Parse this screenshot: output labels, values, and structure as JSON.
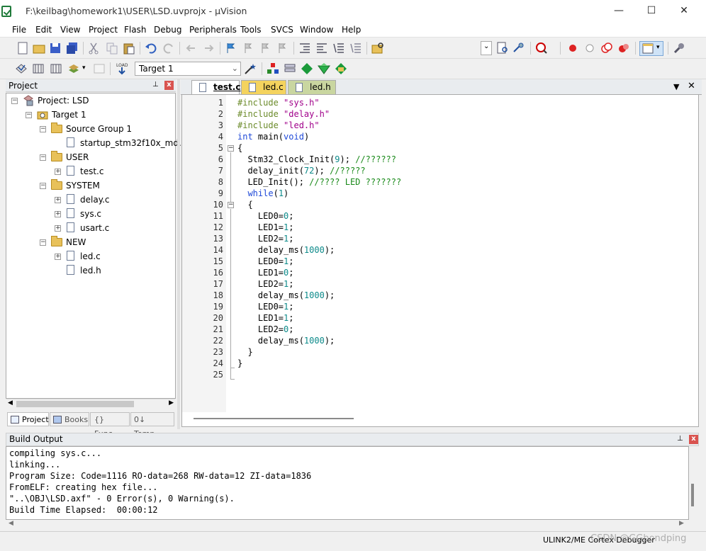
{
  "window": {
    "title": "F:\\keilbag\\homework1\\USER\\LSD.uvprojx - µVision",
    "min": "—",
    "max": "☐",
    "close": "✕"
  },
  "menu": [
    "File",
    "Edit",
    "View",
    "Project",
    "Flash",
    "Debug",
    "Peripherals",
    "Tools",
    "SVCS",
    "Window",
    "Help"
  ],
  "build_toolbar": {
    "target_select": "Target 1"
  },
  "project_panel": {
    "title": "Project",
    "pin": "📌",
    "close": "x",
    "root": "Project: LSD",
    "target": "Target 1",
    "groups": [
      {
        "name": "Source Group 1",
        "files": [
          "startup_stm32f10x_md.s"
        ]
      },
      {
        "name": "USER",
        "files": [
          "test.c"
        ]
      },
      {
        "name": "SYSTEM",
        "files": [
          "delay.c",
          "sys.c",
          "usart.c"
        ]
      },
      {
        "name": "NEW",
        "files": [
          "led.c",
          "led.h"
        ]
      }
    ],
    "bottom_tabs": [
      "Project",
      "Books",
      "{} Func...",
      "0↓ Temp..."
    ]
  },
  "editor": {
    "tabs": [
      "test.c",
      "led.c",
      "led.h"
    ],
    "active_tab": "test.c",
    "line_numbers": [
      "1",
      "2",
      "3",
      "4",
      "5",
      "6",
      "7",
      "8",
      "9",
      "10",
      "11",
      "12",
      "13",
      "14",
      "15",
      "16",
      "17",
      "18",
      "19",
      "20",
      "21",
      "22",
      "23",
      "24",
      "25"
    ]
  },
  "build_output": {
    "title": "Build Output",
    "lines": [
      "compiling sys.c...",
      "linking...",
      "Program Size: Code=1116 RO-data=268 RW-data=12 ZI-data=1836",
      "FromELF: creating hex file...",
      "\"..\\OBJ\\LSD.axf\" - 0 Error(s), 0 Warning(s).",
      "Build Time Elapsed:  00:00:12"
    ]
  },
  "status": {
    "debugger": "ULINK2/ME Cortex Debugger",
    "watermark": "CSDN @GGbondping"
  },
  "colors": {
    "keyword": "#1f49d8",
    "string": "#a0008a",
    "preprocessor": "#6b8b2a",
    "number": "#0c8a8a",
    "comment": "#1a8a1a"
  }
}
